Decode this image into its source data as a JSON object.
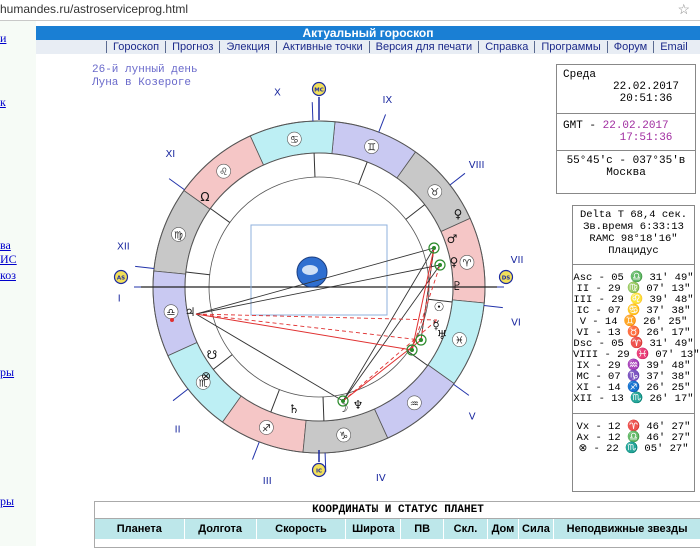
{
  "browser": {
    "url": "humandes.ru/astroserviceprog.html"
  },
  "left_links": [
    "и",
    "к",
    "ва",
    "ИС",
    "коз",
    "ры",
    "ры"
  ],
  "header": {
    "title": "Актуальный гороскоп",
    "menu": [
      "Гороскоп",
      "Прогноз",
      "Элекция",
      "Активные точки",
      "Версия для печати",
      "Справка",
      "Программы",
      "Форум",
      "Email"
    ]
  },
  "moon": {
    "day": "26-й лунный день",
    "sign": "Луна в Козероге"
  },
  "datetime": {
    "weekday": "Среда",
    "date": "22.02.2017",
    "time": "20:51:36",
    "gmt_label": "GMT -",
    "gmt_date": "22.02.2017",
    "gmt_time": "17:51:36",
    "coords": "55°45'с - 037°35'в",
    "city": "Москва"
  },
  "houses_box": {
    "delta_t": "Delta T  68,4 сек.",
    "sidereal": "Зв.время 6:33:13",
    "ramc": "RAMC 98°18'16\"",
    "system": "Плацидус",
    "rows": [
      "Asc - 05 ♎ 31' 49\"",
      "II - 29 ♍ 07' 13\"",
      "III - 29 ♌ 39' 48\"",
      "IC - 07 ♋ 37' 38\"",
      "V - 14 ♊ 26' 25\"",
      "VI - 13 ♉ 26' 17\"",
      "Dsc - 05 ♈ 31' 49\"",
      "VIII - 29 ♓ 07' 13\"",
      "IX - 29 ♒ 39' 48\"",
      "MC - 07 ♑ 37' 38\"",
      "XI - 14 ♐ 26' 25\"",
      "XII - 13 ♏ 26' 17\""
    ],
    "points": [
      "Vx - 12 ♈ 46' 27\"",
      "Ax - 12 ♎ 46' 27\"",
      "⊗ - 22 ♏ 05' 27\""
    ]
  },
  "chart": {
    "houses": [
      "I",
      "II",
      "III",
      "IV",
      "V",
      "VI",
      "VII",
      "VIII",
      "IX",
      "X",
      "XI",
      "XII"
    ],
    "axis_labels": {
      "mc": "MC",
      "ic": "IC",
      "asc": "AS",
      "dsc": "DS"
    },
    "signs": [
      "♈",
      "♉",
      "♊",
      "♋",
      "♌",
      "♍",
      "♎",
      "♏",
      "♐",
      "♑",
      "♒",
      "♓"
    ],
    "planets": [
      "♃",
      "♄",
      "♆",
      "♅",
      "☽",
      "♂",
      "♀",
      "☉",
      "☿",
      "♀",
      "♇",
      "Ω",
      "☋",
      "⊗"
    ]
  },
  "coords_table": {
    "title": "КООРДИНАТЫ И СТАТУС ПЛАНЕТ",
    "columns": [
      "Планета",
      "Долгота",
      "Скорость",
      "Широта",
      "ПВ",
      "Скл.",
      "Дом",
      "Сила",
      "Неподвижные звезды"
    ]
  },
  "colors": {
    "title_bg": "#1a7fd4",
    "fire": "#f5c6c6",
    "earth": "#c8c8c8",
    "air": "#c9c9f2",
    "water": "#bdeff4",
    "lines_red": "#e03030"
  }
}
